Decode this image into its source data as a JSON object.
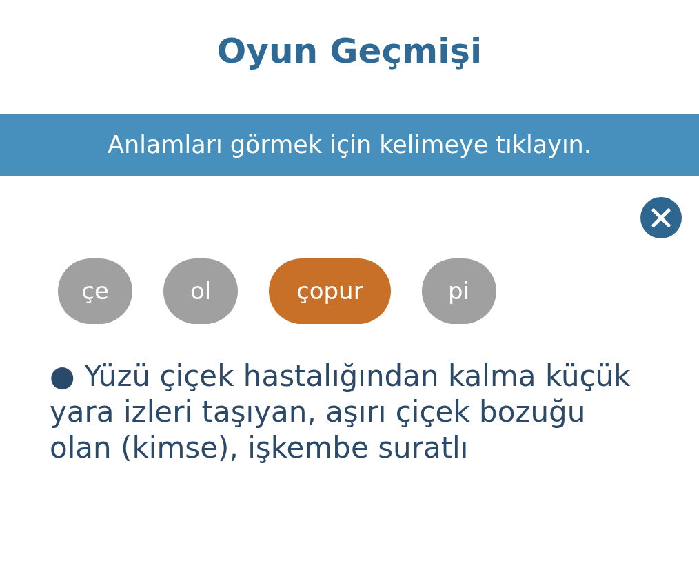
{
  "title": "Oyun Geçmişi",
  "banner": {
    "text": "Anlamları görmek için kelimeye tıklayın."
  },
  "words": [
    {
      "label": "çe",
      "selected": false
    },
    {
      "label": "ol",
      "selected": false
    },
    {
      "label": "çopur",
      "selected": true
    },
    {
      "label": "pi",
      "selected": false
    }
  ],
  "definition": "● Yüzü çiçek hastalığından kalma küçük yara izleri taşıyan, aşırı çiçek bozuğu olan (kimse), işkembe suratlı"
}
